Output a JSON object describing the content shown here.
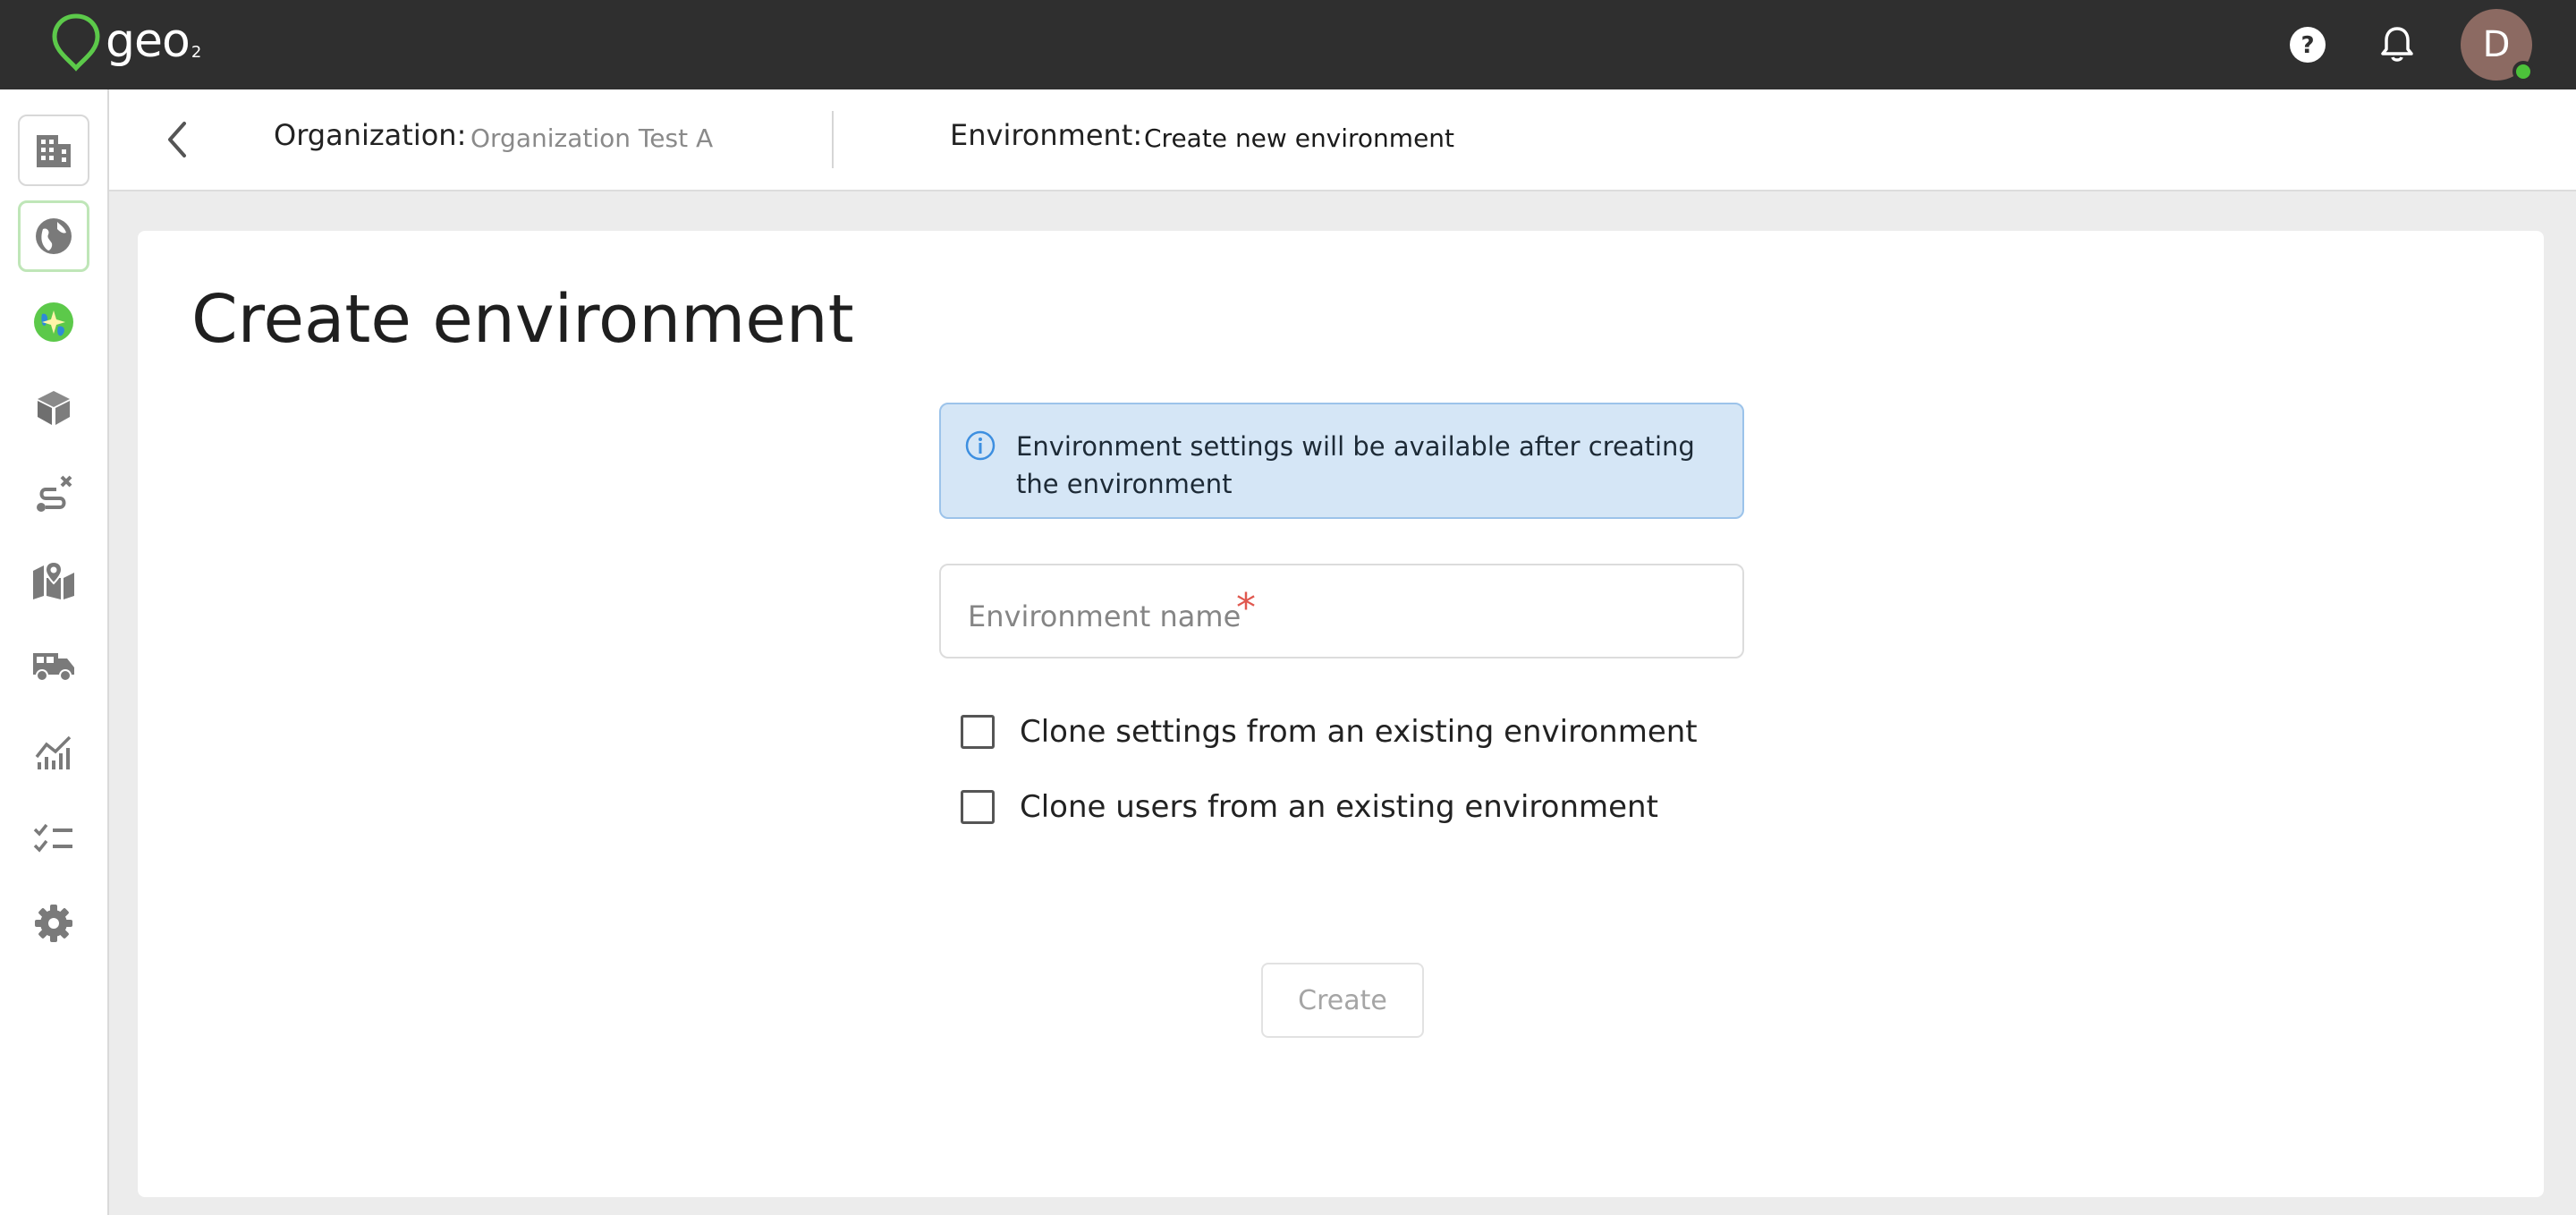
{
  "app": {
    "logo_text": "geo",
    "logo_sub": "2",
    "avatar_initial": "D",
    "colors": {
      "brand_green": "#5cc94a",
      "topbar": "#2f2f2f",
      "info_bg": "#d5e6f6",
      "required": "#e0584f"
    }
  },
  "topbar": {
    "icons": [
      "help-icon",
      "bell-icon"
    ]
  },
  "sidebar": {
    "items": [
      {
        "icon": "building-icon"
      },
      {
        "icon": "globe-icon"
      },
      {
        "icon": "sparkle-globe-icon"
      },
      {
        "icon": "package-icon"
      },
      {
        "icon": "route-icon"
      },
      {
        "icon": "map-pin-icon"
      },
      {
        "icon": "truck-icon"
      },
      {
        "icon": "analytics-icon"
      },
      {
        "icon": "checklist-icon"
      },
      {
        "icon": "gear-icon"
      }
    ]
  },
  "breadcrumb": {
    "org_label": "Organization:",
    "org_value": "Organization Test A",
    "env_label": "Environment:",
    "env_value": "Create new environment"
  },
  "main": {
    "title": "Create environment",
    "info_text": "Environment settings will be available after creating the environment",
    "name_placeholder": "Environment name",
    "name_value": "",
    "required_mark": "*",
    "clone_settings_label": "Clone settings from an existing environment",
    "clone_users_label": "Clone users from an existing environment",
    "create_label": "Create"
  }
}
